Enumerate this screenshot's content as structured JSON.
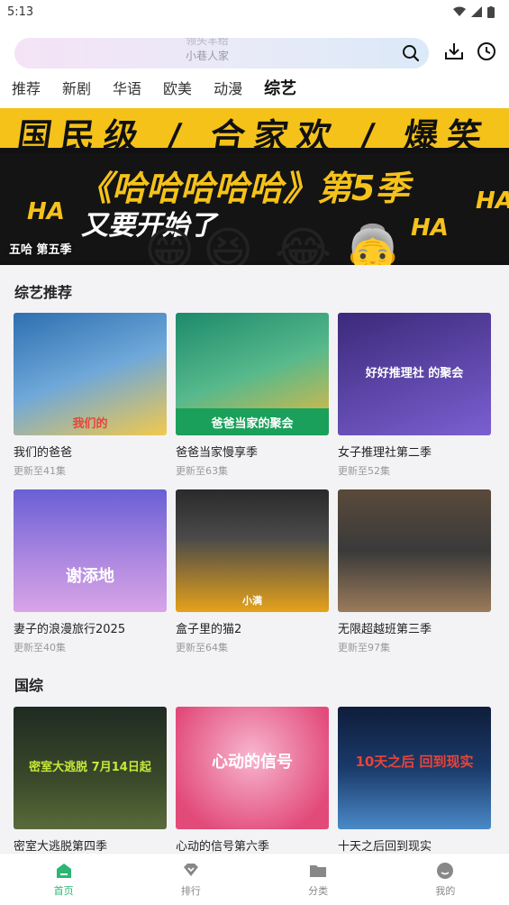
{
  "status": {
    "time": "5:13"
  },
  "search": {
    "placeholder_prev": "领头羊给",
    "placeholder": "小巷人家"
  },
  "tabs": [
    {
      "label": "推荐"
    },
    {
      "label": "新剧"
    },
    {
      "label": "华语"
    },
    {
      "label": "欧美"
    },
    {
      "label": "动漫"
    },
    {
      "label": "综艺"
    }
  ],
  "active_tab": "综艺",
  "banner": {
    "top_text": "国民级 / 合家欢 / 爆笑",
    "headline": "《哈哈哈哈哈》第5季",
    "subline": "又要开始了",
    "ha": "HA",
    "caption": "五哈  第五季"
  },
  "sections": [
    {
      "title": "综艺推荐",
      "items": [
        {
          "name": "我们的爸爸",
          "episodes": "更新至41集",
          "overlay": "我们的",
          "color1": "#2d6fb0",
          "color2": "#f2c94c"
        },
        {
          "name": "爸爸当家慢享季",
          "episodes": "更新至63集",
          "overlay": "爸爸当家的聚会",
          "color1": "#1d8a6b",
          "color2": "#f0b93a"
        },
        {
          "name": "女子推理社第二季",
          "episodes": "更新至52集",
          "overlay": "好好推理社 的聚会",
          "color1": "#3b2a7a",
          "color2": "#7b5fd1"
        },
        {
          "name": "妻子的浪漫旅行2025",
          "episodes": "更新至40集",
          "overlay": "谢添地",
          "color1": "#6a5fd6",
          "color2": "#d8a4e8"
        },
        {
          "name": "盒子里的猫2",
          "episodes": "更新至64集",
          "overlay": "小满",
          "color1": "#e6a21a",
          "color2": "#2a2a2a"
        },
        {
          "name": "无限超越班第三季",
          "episodes": "更新至97集",
          "overlay": "",
          "color1": "#3a3a3a",
          "color2": "#9b7b5a"
        }
      ]
    },
    {
      "title": "国综",
      "items": [
        {
          "name": "密室大逃脱第四季",
          "episodes": "",
          "overlay": "密室大逃脱 7月14日起",
          "color1": "#1f2a22",
          "color2": "#5a6b3a"
        },
        {
          "name": "心动的信号第六季",
          "episodes": "",
          "overlay": "心动的信号",
          "color1": "#e24a7a",
          "color2": "#f7b6cf"
        },
        {
          "name": "十天之后回到现实",
          "episodes": "",
          "overlay": "10天之后 回到现实",
          "color1": "#1a3a6a",
          "color2": "#4a8ac8"
        }
      ]
    }
  ],
  "nav": [
    {
      "label": "首页",
      "icon": "home-icon"
    },
    {
      "label": "排行",
      "icon": "ranking-icon"
    },
    {
      "label": "分类",
      "icon": "folder-icon"
    },
    {
      "label": "我的",
      "icon": "profile-icon"
    }
  ],
  "colors": {
    "accent": "#2bb673",
    "dot": "#e8443a",
    "banner_yellow": "#f5c21a"
  }
}
